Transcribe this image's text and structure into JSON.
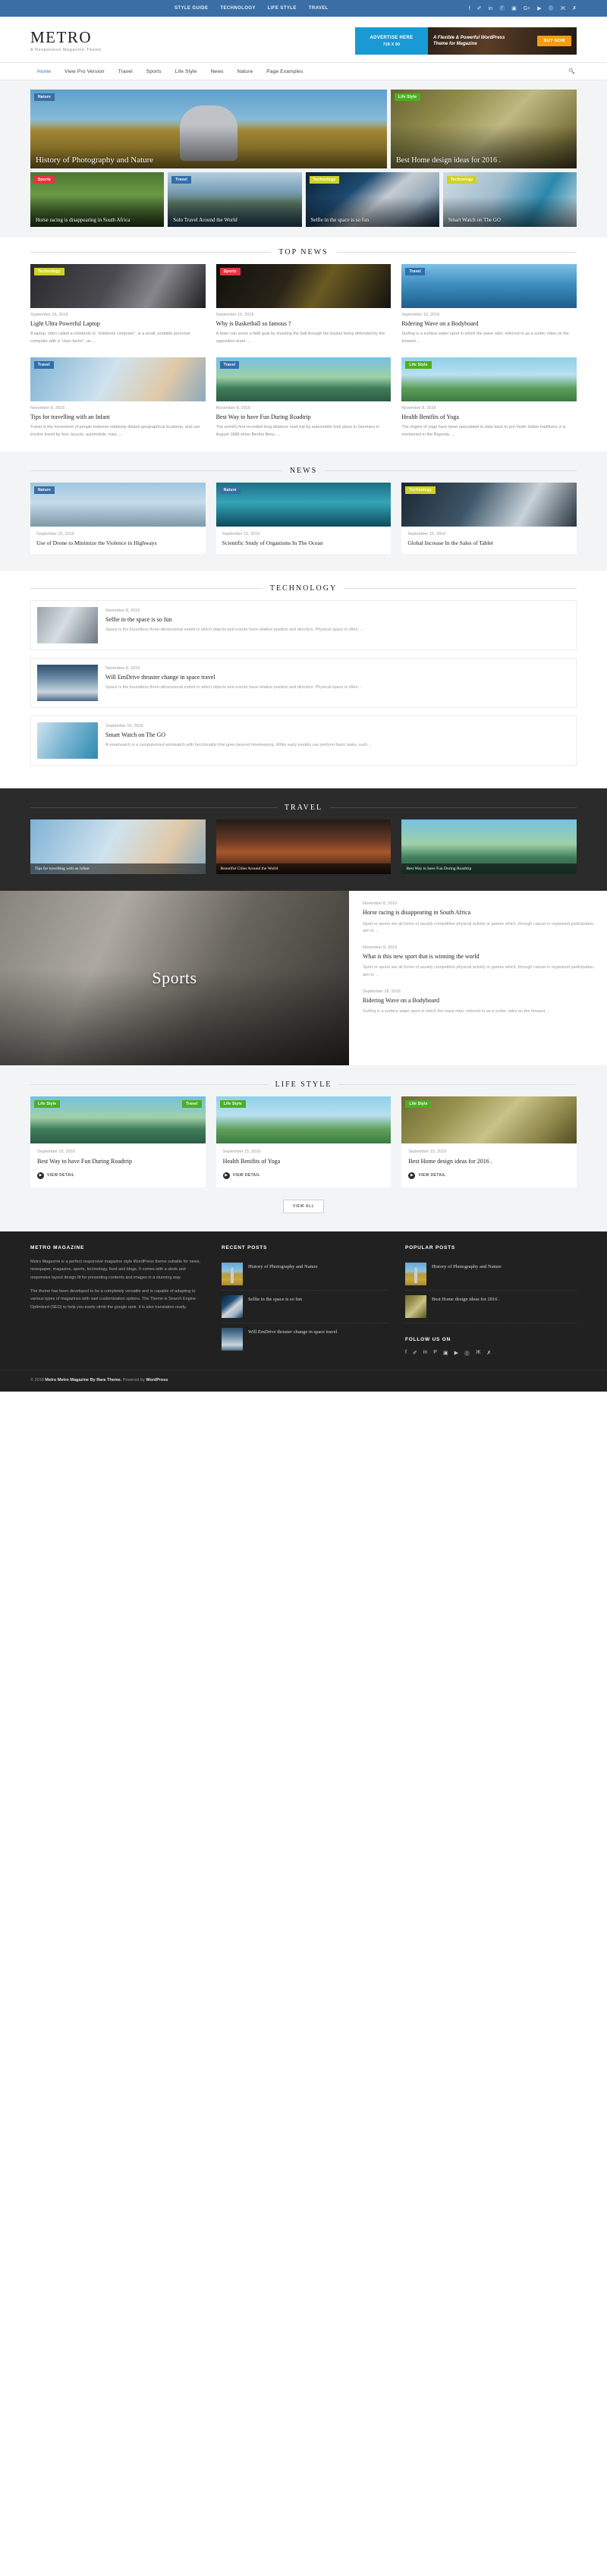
{
  "topbar": {
    "links": [
      "STYLE GUIDE",
      "TECHNOLOGY",
      "LIFE STYLE",
      "TRAVEL"
    ],
    "social": [
      "facebook-icon",
      "twitter-icon",
      "linkedin-icon",
      "pinterest-icon",
      "instagram-icon",
      "googleplus-icon",
      "youtube-icon",
      "odnoklassniki-icon",
      "vk-icon",
      "xing-icon"
    ],
    "social_glyphs": [
      "f",
      "✐",
      "in",
      "Ⓟ",
      "▣",
      "G+",
      "▶",
      "Ⓞ",
      "Ж",
      "✗"
    ],
    "bg": "#3a6ea5"
  },
  "header": {
    "logo": "METRO",
    "tagline": "A Responsive Magazine Theme",
    "ad_box": {
      "line1": "ADVERTISE HERE",
      "line2": "728 X 90"
    },
    "ad_banner": {
      "text": "A Flexible & Powerful WordPress Theme for Magazine",
      "button": "BUY NOW"
    }
  },
  "nav": {
    "items": [
      "Home",
      "View Pro Version",
      "Travel",
      "Sports",
      "Life Style",
      "News",
      "Nature",
      "Page Examples"
    ],
    "active": "Home",
    "search_icon": "search-icon"
  },
  "slider": {
    "main": {
      "category": "Nature",
      "title": "History of Photography and Nature"
    },
    "side": {
      "category": "Life Style",
      "title": "Best Home design ideas for 2016 ."
    },
    "small": [
      {
        "category": "Sports",
        "title": "Horse racing is disappearing in South Africa"
      },
      {
        "category": "Travel",
        "title": "Solo Travel Around the World"
      },
      {
        "category": "Technology",
        "title": "Selfie in the space is so fun"
      },
      {
        "category": "Technology",
        "title": "Smart Watch on The GO"
      }
    ]
  },
  "top_news": {
    "heading": "TOP NEWS",
    "row1": [
      {
        "category": "Technology",
        "date": "September 15, 2016",
        "title": "Light Ultra Powerful Laptop",
        "excerpt": "A laptop, often called a notebook or “notebook computer”, is a small, portable personal computer with a “clam factor”, an ..."
      },
      {
        "category": "Sports",
        "date": "September 15, 2016",
        "title": "Why is Basketball so famous ?",
        "excerpt": "A team can score a field goal by shooting the ball through the basket being defended by the opposition team ..."
      },
      {
        "category": "Travel",
        "date": "September 15, 2016",
        "title": "Ridering Wave on a Bodyboard",
        "excerpt": "Surfing is a surface water sport in which the wave rider, referred to as a surfer, rides on the forward ..."
      }
    ],
    "row2": [
      {
        "category": "Travel",
        "date": "November 8, 2016",
        "title": "Tips for travelling with an Infant",
        "excerpt": "Travel is the movement of people between relatively distant geographical locations, and can involve travel by foot, bicycle, automobile, train, ..."
      },
      {
        "category": "Travel",
        "date": "November 8, 2016",
        "title": "Best Way to have Fun During Roadtrip",
        "excerpt": "The world's first recorded long distance road trip by automobile took place in Germany in August 1888 when Bertha Benz, ..."
      },
      {
        "category": "Life Style",
        "date": "November 8, 2016",
        "title": "Health Benifits of Yoga",
        "excerpt": "The origins of yoga have been speculated to date back to pre-Vedic Indian traditions; it is mentioned in the Rigveda, ..."
      }
    ]
  },
  "news": {
    "heading": "NEWS",
    "items": [
      {
        "category": "Nature",
        "date": "September 15, 2016",
        "title": "Use of Drone to Minimize the Violence in Highways"
      },
      {
        "category": "Nature",
        "date": "September 15, 2016",
        "title": "Scientific Study of Organisms In The Ocean"
      },
      {
        "category": "Technology",
        "date": "September 15, 2016",
        "title": "Global Increase In the Sales of Tablet"
      }
    ]
  },
  "technology": {
    "heading": "TECHNOLOGY",
    "items": [
      {
        "date": "November 8, 2016",
        "title": "Selfie in the space is so fun",
        "excerpt": "Space is the boundless three-dimensional extent in which objects and events have relative position and direction. Physical space is often ..."
      },
      {
        "date": "November 8, 2016",
        "title": "Will EmDrive thruster change in space travel",
        "excerpt": "Space is the boundless three-dimensional extent in which objects and events have relative position and direction. Physical space is often ..."
      },
      {
        "date": "September 16, 2016",
        "title": "Smart Watch on The GO",
        "excerpt": "A smartwatch is a computerized wristwatch with functionality that goes beyond timekeeping. While early models can perform basic tasks, such ..."
      }
    ]
  },
  "travel": {
    "heading": "TRAVEL",
    "items": [
      {
        "title": "Tips for travelling with an infant"
      },
      {
        "title": "Beautiful Cities Around the World"
      },
      {
        "title": "Best Way to have Fun During Roadtrip"
      }
    ]
  },
  "sports": {
    "title": "Sports",
    "items": [
      {
        "date": "November 8, 2016",
        "title": "Horse racing is disappearing in South Africa",
        "excerpt": "Sport or sports are all forms of usually competitive physical activity or games which, through casual or organized participation, aim to ..."
      },
      {
        "date": "November 8, 2016",
        "title": "What is this new sport that is winning the world",
        "excerpt": "Sport or sports are all forms of usually competitive physical activity or games which, through casual or organized participation, aim to ..."
      },
      {
        "date": "September 18, 2016",
        "title": "Ridering Wave on a Bodyboard",
        "excerpt": "Surfing is a surface water sport in which the wave rider, referred to as a surfer, rides on the forward ..."
      }
    ]
  },
  "lifestyle": {
    "heading": "LIFE STYLE",
    "view_all": "VIEW ALL",
    "detail_label": "VIEW DETAIL",
    "items": [
      {
        "categories": [
          "Life Style",
          "Travel"
        ],
        "date": "September 15, 2016",
        "title": "Best Way to have Fun During Roadtrip"
      },
      {
        "categories": [
          "Life Style"
        ],
        "date": "September 15, 2016",
        "title": "Health Benifits of Yoga"
      },
      {
        "categories": [
          "Life Style"
        ],
        "date": "September 15, 2016",
        "title": "Best Home design ideas for 2016 ."
      }
    ]
  },
  "footer": {
    "about_heading": "METRO MAGAZINE",
    "about_p1": "Metro Magazine is a perfect responsive magazine style WordPress theme suitable for news, newspaper, magazine, sports, technology, food and blogs. It comes with a sleek and responsive layout design fit for presenting contents and images in a stunning way.",
    "about_p2": "The theme has been developed to be a completely versatile and is capable of adapting to various types of magazines with vast customization options. The Theme is Search Engine Optimized (SEO) to help you easily climb the google rank. It is also translation ready.",
    "recent_heading": "RECENT POSTS",
    "recent": [
      {
        "title": "History of Photography and Nature"
      },
      {
        "title": "Selfie in the space is so fun"
      },
      {
        "title": "Will EmDrive thruster change in space travel"
      }
    ],
    "popular_heading": "POPULAR POSTS",
    "popular": [
      {
        "title": "History of Photography and Nature"
      },
      {
        "title": "Best Home design ideas for 2016 ."
      }
    ],
    "follow_heading": "FOLLOW US ON",
    "social_glyphs": [
      "f",
      "✐",
      "in",
      "P",
      "▣",
      "▶",
      "Ⓞ",
      "Ж",
      "✗"
    ],
    "copyright_year": "© 2018",
    "copyright_bold": "Metro Metro Magazine By Rara Theme.",
    "copyright_rest": "Powered by ",
    "copyright_wp": "WordPress"
  }
}
